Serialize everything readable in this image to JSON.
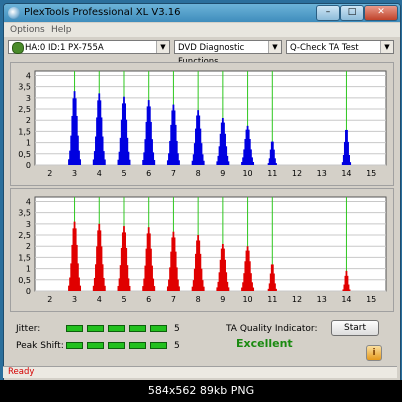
{
  "window": {
    "title": "PlexTools Professional XL V3.16",
    "buttons": {
      "minimize": "–",
      "maximize": "□",
      "close": "✕"
    }
  },
  "menu": [
    "Options",
    "Help"
  ],
  "toolbar": {
    "drive": "HA:0 ID:1  PX-755A",
    "function": "DVD Diagnostic Functions",
    "test": "Q-Check TA Test"
  },
  "chart_data": [
    {
      "type": "bar",
      "name": "upper chart",
      "color": "#0000e0",
      "x_ticks": [
        2,
        3,
        4,
        5,
        6,
        7,
        8,
        9,
        10,
        11,
        12,
        13,
        14,
        15
      ],
      "y_ticks": [
        "0",
        "0,5",
        "1",
        "1,5",
        "2",
        "2,5",
        "3",
        "3,5",
        "4"
      ],
      "ylim": [
        0,
        4.2
      ],
      "xlim": [
        1.4,
        15.6
      ],
      "green_lines": [
        3,
        4,
        5,
        6,
        7,
        8,
        9,
        10,
        11,
        14
      ],
      "peaks": [
        {
          "x": 3,
          "height": 3.3,
          "width": 0.45
        },
        {
          "x": 4,
          "height": 3.2,
          "width": 0.45
        },
        {
          "x": 5,
          "height": 3.05,
          "width": 0.45
        },
        {
          "x": 6,
          "height": 2.9,
          "width": 0.45
        },
        {
          "x": 7,
          "height": 2.7,
          "width": 0.45
        },
        {
          "x": 8,
          "height": 2.45,
          "width": 0.45
        },
        {
          "x": 9,
          "height": 2.1,
          "width": 0.45
        },
        {
          "x": 10,
          "height": 1.75,
          "width": 0.45
        },
        {
          "x": 11,
          "height": 1.1,
          "width": 0.3
        },
        {
          "x": 14,
          "height": 1.65,
          "width": 0.3
        }
      ]
    },
    {
      "type": "bar",
      "name": "lower chart",
      "color": "#e00000",
      "x_ticks": [
        2,
        3,
        4,
        5,
        6,
        7,
        8,
        9,
        10,
        11,
        12,
        13,
        14,
        15
      ],
      "y_ticks": [
        "0",
        "0,5",
        "1",
        "1,5",
        "2",
        "2,5",
        "3",
        "3,5",
        "4"
      ],
      "ylim": [
        0,
        4.2
      ],
      "xlim": [
        1.4,
        15.6
      ],
      "green_lines": [
        3,
        4,
        5,
        6,
        7,
        8,
        9,
        10,
        11,
        14
      ],
      "peaks": [
        {
          "x": 3,
          "height": 3.1,
          "width": 0.45
        },
        {
          "x": 4,
          "height": 3.0,
          "width": 0.45
        },
        {
          "x": 5,
          "height": 2.9,
          "width": 0.45
        },
        {
          "x": 6,
          "height": 2.85,
          "width": 0.45
        },
        {
          "x": 7,
          "height": 2.65,
          "width": 0.45
        },
        {
          "x": 8,
          "height": 2.5,
          "width": 0.45
        },
        {
          "x": 9,
          "height": 2.1,
          "width": 0.45
        },
        {
          "x": 10,
          "height": 2.0,
          "width": 0.45
        },
        {
          "x": 11,
          "height": 1.25,
          "width": 0.3
        },
        {
          "x": 14,
          "height": 0.9,
          "width": 0.25
        }
      ]
    }
  ],
  "results": {
    "jitter_label": "Jitter:",
    "jitter_value": "5",
    "jitter_level": 5,
    "peak_shift_label": "Peak Shift:",
    "peak_shift_value": "5",
    "peak_shift_level": 5,
    "ta_label": "TA Quality Indicator:",
    "ta_result": "Excellent",
    "ta_color": "#1a8a10",
    "start_label": "Start",
    "info_icon": "i"
  },
  "status": "Ready",
  "caption": "584x562  89kb  PNG"
}
